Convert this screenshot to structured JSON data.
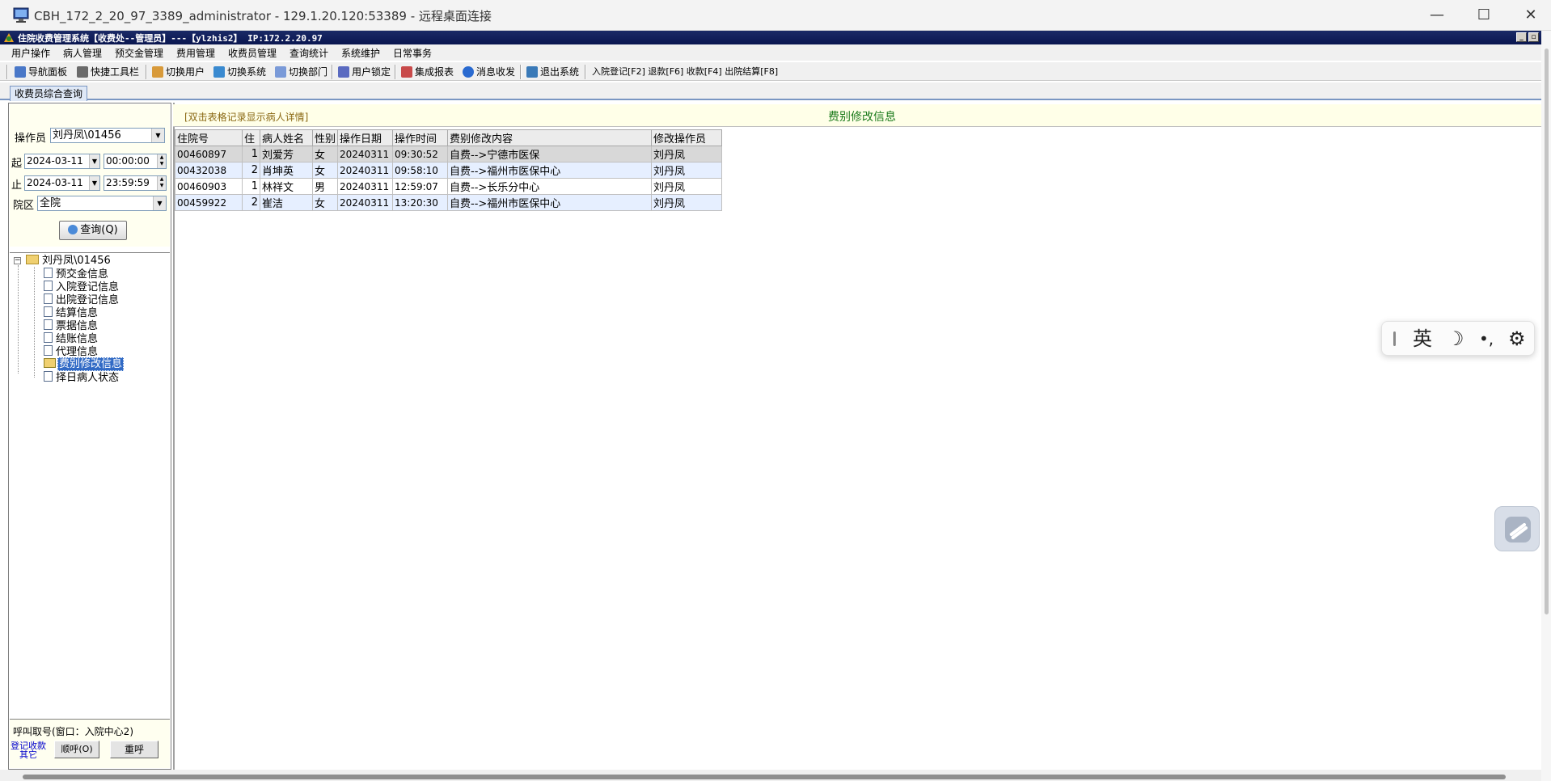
{
  "window": {
    "title": "CBH_172_2_20_97_3389_administrator - 129.1.20.120:53389 - 远程桌面连接",
    "minimize_glyph": "—",
    "maximize_glyph": "☐",
    "close_glyph": "✕"
  },
  "app": {
    "title": "住院收费管理系统【收费处--管理员】---【ylzhis2】 IP:172.2.20.97"
  },
  "menu": [
    "用户操作",
    "病人管理",
    "预交金管理",
    "费用管理",
    "收费员管理",
    "查询统计",
    "系统维护",
    "日常事务"
  ],
  "toolbar": {
    "items": [
      "导航面板",
      "快捷工具栏",
      "切换用户",
      "切换系统",
      "切换部门",
      "用户锁定",
      "集成报表",
      "消息收发",
      "退出系统"
    ],
    "shortcuts": "入院登记[F2] 退款[F6] 收款[F4] 出院结算[F8]"
  },
  "tab": {
    "label": "收费员综合查询"
  },
  "filter": {
    "operator_label": "操作员",
    "operator_value": "刘丹凤\\01456",
    "start_label": "起",
    "start_date": "2024-03-11",
    "start_time": "00:00:00",
    "end_label": "止",
    "end_date": "2024-03-11",
    "end_time": "23:59:59",
    "campus_label": "院区",
    "campus_value": "全院",
    "query_button": "查询(Q)"
  },
  "tree": {
    "root": "刘丹凤\\01456",
    "items": [
      "预交金信息",
      "入院登记信息",
      "出院登记信息",
      "结算信息",
      "票据信息",
      "结账信息",
      "代理信息",
      "费别修改信息",
      "择日病人状态"
    ],
    "selected": "费别修改信息"
  },
  "call": {
    "group_label": "呼叫取号(窗口：入院中心2)",
    "link_line1": "登记收款",
    "link_line2": "其它",
    "sequential_button": "顺呼(O)",
    "recall_button": "重呼"
  },
  "grid": {
    "hint": "[双击表格记录显示病人详情]",
    "title": "费别修改信息",
    "columns": [
      "住院号",
      "住",
      "病人姓名",
      "性别",
      "操作日期",
      "操作时间",
      "费别修改内容",
      "修改操作员"
    ],
    "rows": [
      [
        "00460897",
        "1",
        "刘爱芳",
        "女",
        "20240311",
        "09:30:52",
        "自费-->宁德市医保",
        "刘丹凤"
      ],
      [
        "00432038",
        "2",
        "肖坤英",
        "女",
        "20240311",
        "09:58:10",
        "自费-->福州市医保中心",
        "刘丹凤"
      ],
      [
        "00460903",
        "1",
        "林祥文",
        "男",
        "20240311",
        "12:59:07",
        "自费-->长乐分中心",
        "刘丹凤"
      ],
      [
        "00459922",
        "2",
        "崔洁",
        "女",
        "20240311",
        "13:20:30",
        "自费-->福州市医保中心",
        "刘丹凤"
      ]
    ]
  },
  "ime": {
    "lang": "英",
    "moon": "☽",
    "punct": "•,",
    "gear": "⚙"
  },
  "colors": {
    "app_titlebar": "#0a1650",
    "hint_text": "#8b6914",
    "grid_title": "#1a7a1a",
    "selected_tree": "#316ac5",
    "row_alt": "#e6efff"
  }
}
